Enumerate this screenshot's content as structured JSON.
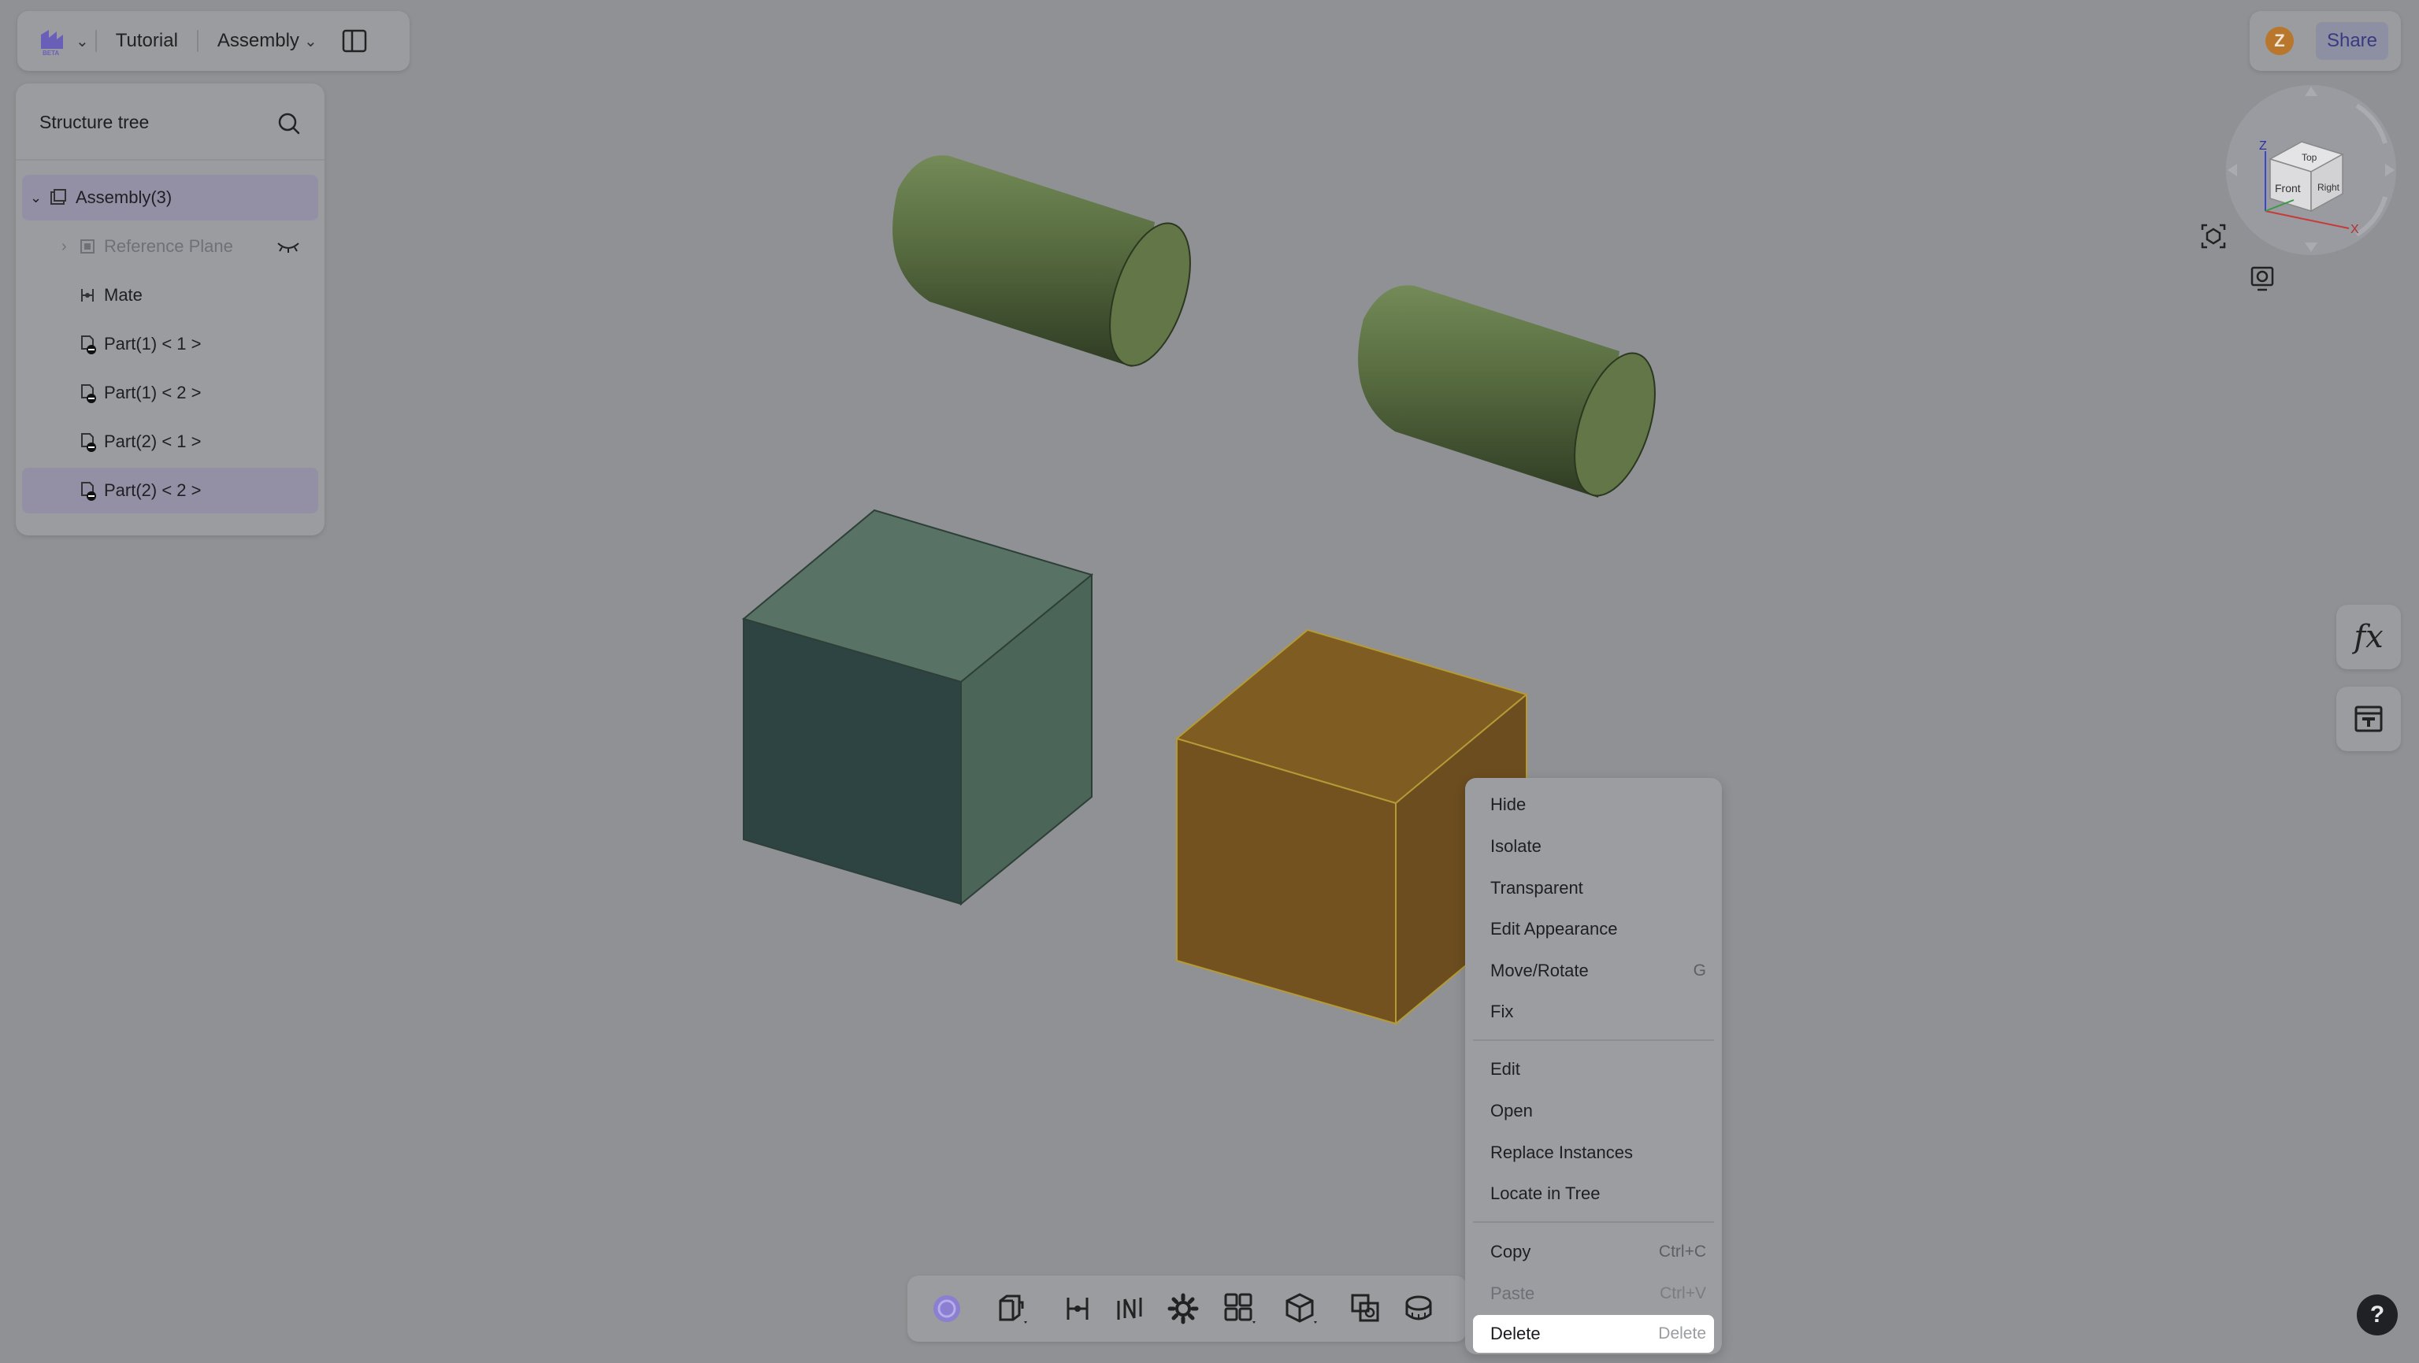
{
  "topbar": {
    "logo_badge": "BETA",
    "tutorial": "Tutorial",
    "assembly": "Assembly"
  },
  "user": {
    "avatar_initial": "Z",
    "share_label": "Share"
  },
  "tree": {
    "title": "Structure tree",
    "items": [
      {
        "label": "Assembly(3)",
        "selected": true
      },
      {
        "label": "Reference Plane",
        "hidden": true
      },
      {
        "label": "Mate"
      },
      {
        "label": "Part(1) < 1 >"
      },
      {
        "label": "Part(1) < 2 >"
      },
      {
        "label": "Part(2) < 1 >"
      },
      {
        "label": "Part(2) < 2 >",
        "selected": true
      }
    ]
  },
  "navcube": {
    "top": "Top",
    "front": "Front",
    "right": "Right",
    "axis_z": "Z",
    "axis_x": "X"
  },
  "side": {
    "fx_label": "fx"
  },
  "menu": {
    "group1": [
      {
        "label": "Hide"
      },
      {
        "label": "Isolate"
      },
      {
        "label": "Transparent"
      },
      {
        "label": "Edit Appearance"
      },
      {
        "label": "Move/Rotate",
        "shortcut": "G"
      },
      {
        "label": "Fix"
      }
    ],
    "group2": [
      {
        "label": "Edit"
      },
      {
        "label": "Open"
      },
      {
        "label": "Replace Instances"
      },
      {
        "label": "Locate in Tree"
      }
    ],
    "group3": [
      {
        "label": "Copy",
        "shortcut": "Ctrl+C"
      },
      {
        "label": "Paste",
        "shortcut": "Ctrl+V",
        "disabled": true
      },
      {
        "label": "Delete",
        "shortcut": "Delete",
        "active": true
      }
    ]
  },
  "help_label": "?",
  "colors": {
    "background": "#8f9194",
    "cylinder": "#5f7247",
    "cube_teal": "#4d6a5e",
    "cube_orange": "#8a6324",
    "accent": "#8c7ed0"
  }
}
